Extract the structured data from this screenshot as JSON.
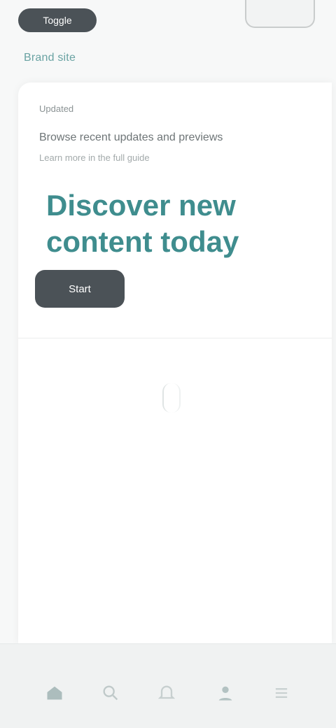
{
  "header": {
    "left_pill_label": "Toggle",
    "brand": "Brand site"
  },
  "hero": {
    "kicker": "Updated",
    "headline": "Browse recent updates and previews",
    "subhead": "Learn more in the full guide",
    "title": "Discover new content today",
    "cta_label": "Start"
  },
  "nav": {
    "home": "home",
    "search": "search",
    "notifications": "notifications",
    "profile": "profile",
    "menu": "menu"
  },
  "colors": {
    "accent": "#3f8d8e",
    "button": "#4b5257"
  }
}
